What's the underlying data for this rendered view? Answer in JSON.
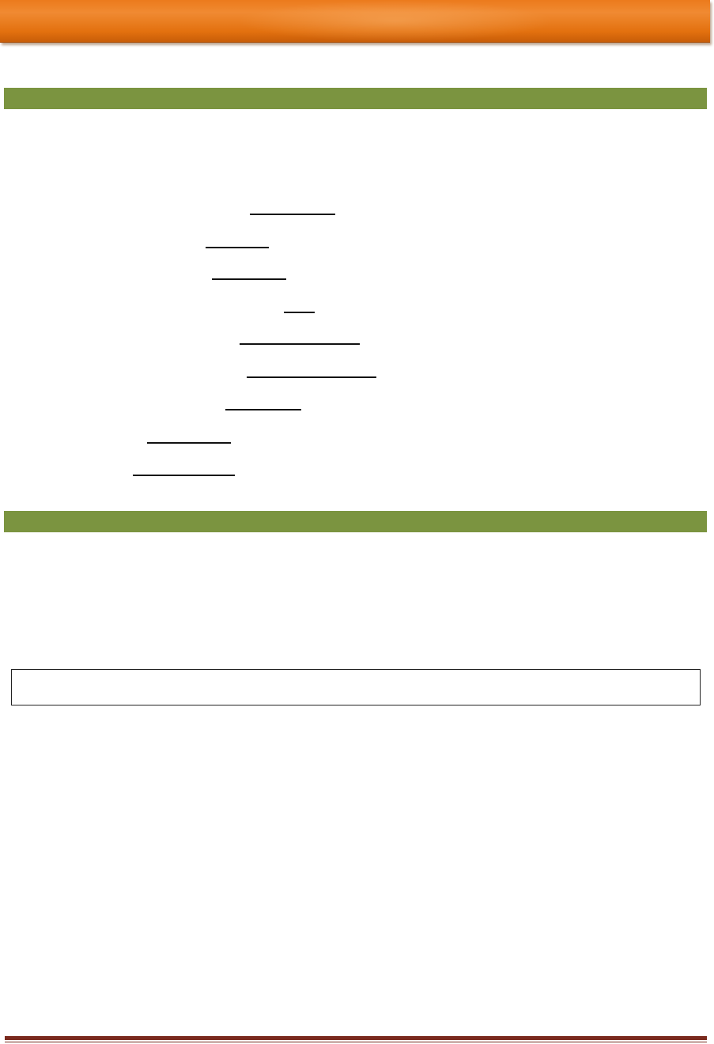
{
  "header": {
    "title": ""
  },
  "sections": [
    {
      "label": ""
    },
    {
      "label": ""
    }
  ],
  "blanks": [
    {
      "value": ""
    },
    {
      "value": ""
    },
    {
      "value": ""
    },
    {
      "value": ""
    },
    {
      "value": ""
    },
    {
      "value": ""
    },
    {
      "value": ""
    },
    {
      "value": ""
    },
    {
      "value": ""
    }
  ],
  "answer_box": {
    "value": ""
  },
  "colors": {
    "header_orange": "#e3710f",
    "section_green": "#7b9440",
    "footer_rule": "#7a2a1e"
  }
}
